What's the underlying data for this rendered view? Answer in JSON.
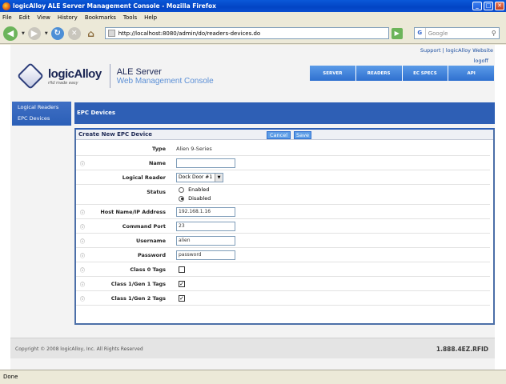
{
  "window": {
    "title": "logicAlloy ALE Server Management Console - Mozilla Firefox",
    "minimize": "_",
    "maximize": "□",
    "close": "✕"
  },
  "menu": [
    "File",
    "Edit",
    "View",
    "History",
    "Bookmarks",
    "Tools",
    "Help"
  ],
  "browser": {
    "url": "http://localhost:8080/admin/do/readers-devices.do",
    "search_placeholder": "Google",
    "status": "Done"
  },
  "site": {
    "top_links": "Support | logicAlloy Website",
    "logoff": "logoff",
    "logo_name": "logicAlloy",
    "logo_tagline": "rfid made easy",
    "product_name": "ALE Server",
    "product_sub": "Web Management Console",
    "nav_tabs": [
      "SERVER",
      "READERS",
      "EC SPECS",
      "API"
    ],
    "sidebar": [
      "Logical Readers",
      "EPC Devices"
    ],
    "section_title": "EPC Devices",
    "copyright": "Copyright © 2008 logicAlloy, Inc.  All Rights Reserved",
    "phone": "1.888.4EZ.RFID"
  },
  "form": {
    "title": "Create New EPC Device",
    "cancel": "Cancel",
    "save": "Save",
    "type_label": "Type",
    "type_value": "Alien 9-Series",
    "name_label": "Name",
    "name_value": "",
    "logical_reader_label": "Logical Reader",
    "logical_reader_value": "Dock Door #1",
    "status_label": "Status",
    "status_enabled": "Enabled",
    "status_disabled": "Disabled",
    "host_label": "Host Name/IP Address",
    "host_value": "192.168.1.16",
    "port_label": "Command Port",
    "port_value": "23",
    "username_label": "Username",
    "username_value": "alien",
    "password_label": "Password",
    "password_value": "password",
    "class0_label": "Class 0 Tags",
    "class0_checked": false,
    "class1g1_label": "Class 1/Gen 1 Tags",
    "class1g1_checked": true,
    "class1g2_label": "Class 1/Gen 2 Tags",
    "class1g2_checked": true,
    "help_glyph": "ⓘ",
    "check_glyph": "✓",
    "dropdown_glyph": "▼"
  }
}
